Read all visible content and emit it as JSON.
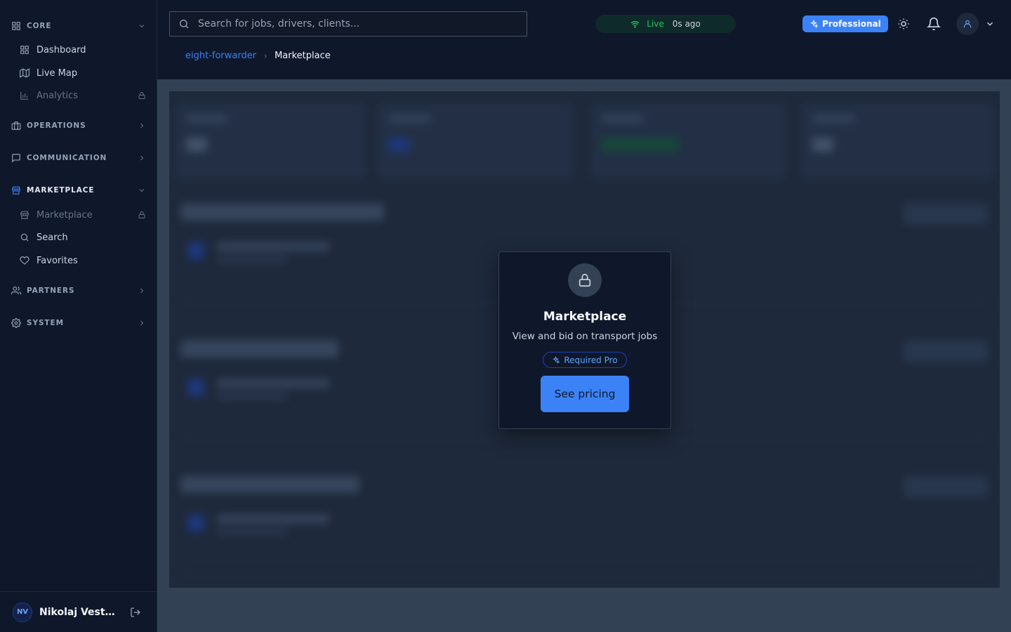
{
  "sidebar": {
    "sections": [
      {
        "label": "CORE",
        "expanded": true
      },
      {
        "label": "OPERATIONS",
        "expanded": false
      },
      {
        "label": "COMMUNICATION",
        "expanded": false
      },
      {
        "label": "MARKETPLACE",
        "expanded": true
      },
      {
        "label": "PARTNERS",
        "expanded": false
      },
      {
        "label": "SYSTEM",
        "expanded": false
      }
    ],
    "core_items": [
      {
        "label": "Dashboard",
        "locked": false
      },
      {
        "label": "Live Map",
        "locked": false
      },
      {
        "label": "Analytics",
        "locked": true
      }
    ],
    "marketplace_items": [
      {
        "label": "Marketplace",
        "locked": true
      },
      {
        "label": "Search",
        "locked": false
      },
      {
        "label": "Favorites",
        "locked": false
      }
    ],
    "user": {
      "initials": "NV",
      "name": "Nikolaj Vestergaard"
    }
  },
  "header": {
    "search_placeholder": "Search for jobs, drivers, clients...",
    "live_label": "Live",
    "live_ago": "0s ago",
    "plan_badge": "Professional"
  },
  "breadcrumb": {
    "parent": "eight-forwarder",
    "current": "Marketplace"
  },
  "modal": {
    "title": "Marketplace",
    "description": "View and bid on transport jobs",
    "required_badge": "Required Pro",
    "button_label": "See pricing"
  },
  "colors": {
    "accent": "#3b82f6",
    "live": "#22c55e",
    "sidebar_bg": "#0f172a"
  }
}
